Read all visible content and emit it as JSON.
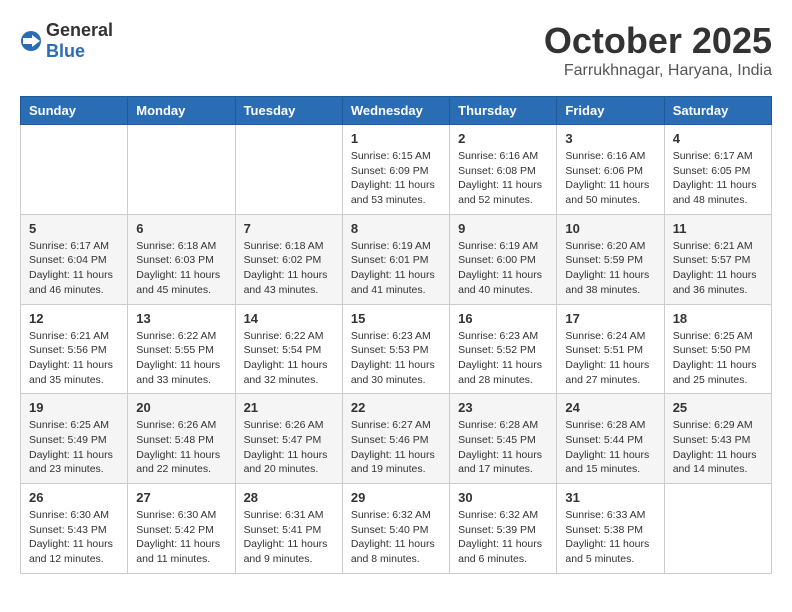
{
  "header": {
    "logo_general": "General",
    "logo_blue": "Blue",
    "month": "October 2025",
    "location": "Farrukhnagar, Haryana, India"
  },
  "weekdays": [
    "Sunday",
    "Monday",
    "Tuesday",
    "Wednesday",
    "Thursday",
    "Friday",
    "Saturday"
  ],
  "weeks": [
    [
      {
        "day": "",
        "info": ""
      },
      {
        "day": "",
        "info": ""
      },
      {
        "day": "",
        "info": ""
      },
      {
        "day": "1",
        "info": "Sunrise: 6:15 AM\nSunset: 6:09 PM\nDaylight: 11 hours\nand 53 minutes."
      },
      {
        "day": "2",
        "info": "Sunrise: 6:16 AM\nSunset: 6:08 PM\nDaylight: 11 hours\nand 52 minutes."
      },
      {
        "day": "3",
        "info": "Sunrise: 6:16 AM\nSunset: 6:06 PM\nDaylight: 11 hours\nand 50 minutes."
      },
      {
        "day": "4",
        "info": "Sunrise: 6:17 AM\nSunset: 6:05 PM\nDaylight: 11 hours\nand 48 minutes."
      }
    ],
    [
      {
        "day": "5",
        "info": "Sunrise: 6:17 AM\nSunset: 6:04 PM\nDaylight: 11 hours\nand 46 minutes."
      },
      {
        "day": "6",
        "info": "Sunrise: 6:18 AM\nSunset: 6:03 PM\nDaylight: 11 hours\nand 45 minutes."
      },
      {
        "day": "7",
        "info": "Sunrise: 6:18 AM\nSunset: 6:02 PM\nDaylight: 11 hours\nand 43 minutes."
      },
      {
        "day": "8",
        "info": "Sunrise: 6:19 AM\nSunset: 6:01 PM\nDaylight: 11 hours\nand 41 minutes."
      },
      {
        "day": "9",
        "info": "Sunrise: 6:19 AM\nSunset: 6:00 PM\nDaylight: 11 hours\nand 40 minutes."
      },
      {
        "day": "10",
        "info": "Sunrise: 6:20 AM\nSunset: 5:59 PM\nDaylight: 11 hours\nand 38 minutes."
      },
      {
        "day": "11",
        "info": "Sunrise: 6:21 AM\nSunset: 5:57 PM\nDaylight: 11 hours\nand 36 minutes."
      }
    ],
    [
      {
        "day": "12",
        "info": "Sunrise: 6:21 AM\nSunset: 5:56 PM\nDaylight: 11 hours\nand 35 minutes."
      },
      {
        "day": "13",
        "info": "Sunrise: 6:22 AM\nSunset: 5:55 PM\nDaylight: 11 hours\nand 33 minutes."
      },
      {
        "day": "14",
        "info": "Sunrise: 6:22 AM\nSunset: 5:54 PM\nDaylight: 11 hours\nand 32 minutes."
      },
      {
        "day": "15",
        "info": "Sunrise: 6:23 AM\nSunset: 5:53 PM\nDaylight: 11 hours\nand 30 minutes."
      },
      {
        "day": "16",
        "info": "Sunrise: 6:23 AM\nSunset: 5:52 PM\nDaylight: 11 hours\nand 28 minutes."
      },
      {
        "day": "17",
        "info": "Sunrise: 6:24 AM\nSunset: 5:51 PM\nDaylight: 11 hours\nand 27 minutes."
      },
      {
        "day": "18",
        "info": "Sunrise: 6:25 AM\nSunset: 5:50 PM\nDaylight: 11 hours\nand 25 minutes."
      }
    ],
    [
      {
        "day": "19",
        "info": "Sunrise: 6:25 AM\nSunset: 5:49 PM\nDaylight: 11 hours\nand 23 minutes."
      },
      {
        "day": "20",
        "info": "Sunrise: 6:26 AM\nSunset: 5:48 PM\nDaylight: 11 hours\nand 22 minutes."
      },
      {
        "day": "21",
        "info": "Sunrise: 6:26 AM\nSunset: 5:47 PM\nDaylight: 11 hours\nand 20 minutes."
      },
      {
        "day": "22",
        "info": "Sunrise: 6:27 AM\nSunset: 5:46 PM\nDaylight: 11 hours\nand 19 minutes."
      },
      {
        "day": "23",
        "info": "Sunrise: 6:28 AM\nSunset: 5:45 PM\nDaylight: 11 hours\nand 17 minutes."
      },
      {
        "day": "24",
        "info": "Sunrise: 6:28 AM\nSunset: 5:44 PM\nDaylight: 11 hours\nand 15 minutes."
      },
      {
        "day": "25",
        "info": "Sunrise: 6:29 AM\nSunset: 5:43 PM\nDaylight: 11 hours\nand 14 minutes."
      }
    ],
    [
      {
        "day": "26",
        "info": "Sunrise: 6:30 AM\nSunset: 5:43 PM\nDaylight: 11 hours\nand 12 minutes."
      },
      {
        "day": "27",
        "info": "Sunrise: 6:30 AM\nSunset: 5:42 PM\nDaylight: 11 hours\nand 11 minutes."
      },
      {
        "day": "28",
        "info": "Sunrise: 6:31 AM\nSunset: 5:41 PM\nDaylight: 11 hours\nand 9 minutes."
      },
      {
        "day": "29",
        "info": "Sunrise: 6:32 AM\nSunset: 5:40 PM\nDaylight: 11 hours\nand 8 minutes."
      },
      {
        "day": "30",
        "info": "Sunrise: 6:32 AM\nSunset: 5:39 PM\nDaylight: 11 hours\nand 6 minutes."
      },
      {
        "day": "31",
        "info": "Sunrise: 6:33 AM\nSunset: 5:38 PM\nDaylight: 11 hours\nand 5 minutes."
      },
      {
        "day": "",
        "info": ""
      }
    ]
  ]
}
